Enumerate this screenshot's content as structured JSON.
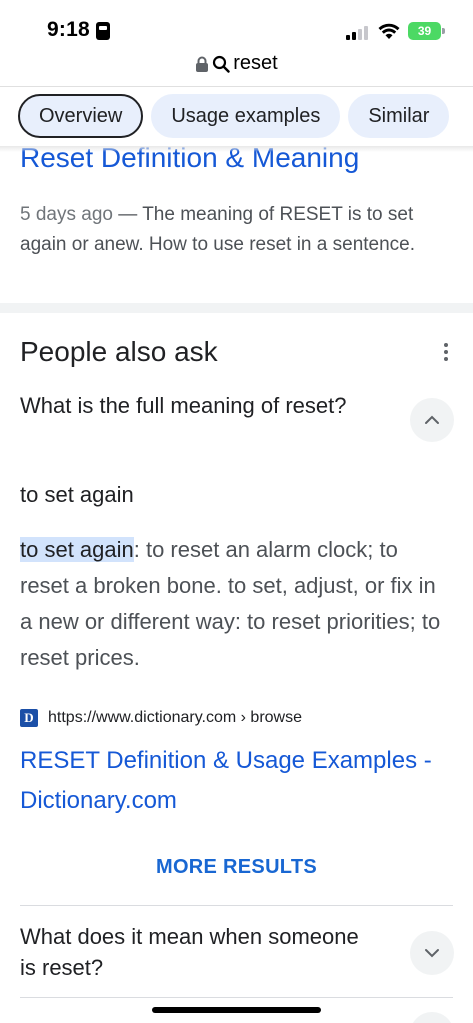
{
  "status_bar": {
    "time": "9:18",
    "battery": "39",
    "colors": {
      "battery": "#4cd964"
    }
  },
  "url_bar": {
    "query": "reset",
    "icons": [
      "lock-icon",
      "search-icon"
    ]
  },
  "chips": [
    {
      "label": "Overview",
      "active": true
    },
    {
      "label": "Usage examples",
      "active": false
    },
    {
      "label": "Similar",
      "active": false
    }
  ],
  "result": {
    "title": "Reset Definition & Meaning",
    "date": "5 days ago",
    "separator": " — ",
    "snippet": "The meaning of RESET is to set again or anew. How to use reset in a sentence."
  },
  "people_also_ask": {
    "heading": "People also ask",
    "questions": [
      {
        "question": "What is the full meaning of reset?",
        "expanded": true,
        "answer_short": "to set again",
        "answer_highlight": "to set again",
        "answer_rest": ": to reset an alarm clock; to reset a broken bone. to set, adjust, or fix in a new or different way: to reset priorities; to reset prices.",
        "source_url": "https://www.dictionary.com › browse",
        "source_title": "RESET Definition & Usage Examples - Dictionary.com",
        "favicon_letter": "D"
      },
      {
        "question": "What does it mean when someone is reset?",
        "expanded": false
      }
    ],
    "more_results": "MORE RESULTS"
  },
  "colors": {
    "link": "#1558d6",
    "chip_bg": "#e8effc",
    "highlight": "#d2e3fc",
    "accent": "#1967d2"
  }
}
